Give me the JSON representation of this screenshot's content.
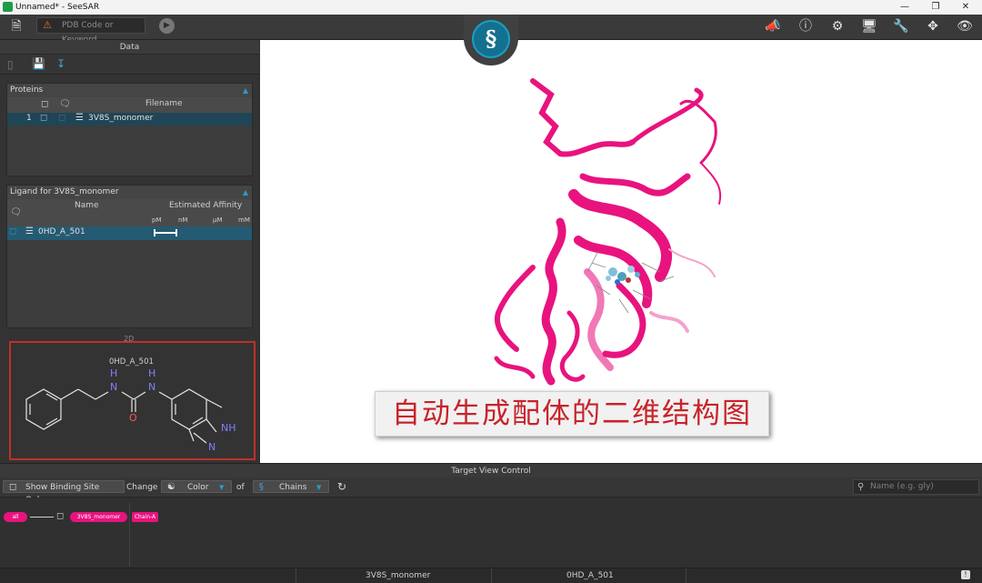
{
  "window": {
    "title": "Unnamed* - SeeSAR"
  },
  "toolbar": {
    "search_placeholder": "PDB Code or Keyword"
  },
  "left_panel": {
    "title": "Data",
    "proteins": {
      "header": "Proteins",
      "column_filename": "Filename",
      "rows": [
        {
          "index": "1",
          "filename": "3V8S_monomer"
        }
      ]
    },
    "ligands": {
      "header": "Ligand for 3V8S_monomer",
      "column_name": "Name",
      "column_affinity": "Estimated Affinity",
      "scale": [
        "pM",
        "nM",
        "µM",
        "mM"
      ],
      "rows": [
        {
          "name": "0HD_A_501"
        }
      ]
    },
    "view2d": {
      "label": "2D",
      "molecule_name": "0HD_A_501",
      "atoms": {
        "nh1": "N",
        "h1": "H",
        "nh2": "N",
        "h2": "H",
        "o": "O",
        "nh3": "NH",
        "n": "N"
      }
    }
  },
  "annotation": {
    "text": "自动生成配体的二维结构图"
  },
  "target_view_control": {
    "title": "Target View Control",
    "show_binding_site": "Show Binding Site Only",
    "change": "Change",
    "color": "Color",
    "of": "of",
    "chains": "Chains",
    "search_placeholder": "Name (e.g. gly)"
  },
  "chains": {
    "all": "all",
    "protein": "3V8S_monomer",
    "chain": "Chain-A"
  },
  "status": {
    "protein": "3V8S_monomer",
    "ligand": "0HD_A_501"
  },
  "colors": {
    "accent": "#2a9ad0",
    "ribbon": "#e8137e",
    "highlight": "#c0302a"
  }
}
